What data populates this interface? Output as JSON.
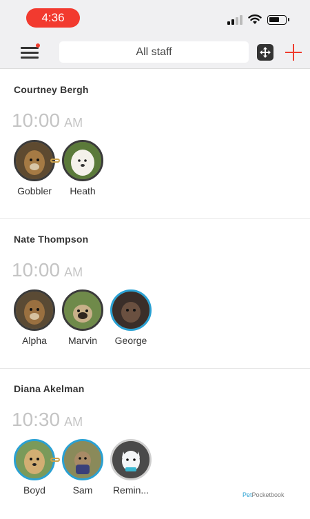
{
  "status_bar": {
    "time": "4:36"
  },
  "toolbar": {
    "filter_label": "All staff"
  },
  "colors": {
    "accent_red": "#ef3b2d",
    "highlight_blue": "#2aa1d3"
  },
  "sections": [
    {
      "staff": "Courtney Bergh",
      "time": "10:00",
      "ampm": "AM",
      "pets": [
        {
          "name": "Gobbler",
          "fur": "#8a6a3a"
        },
        {
          "name": "Heath",
          "fur": "#f3f0ea"
        }
      ]
    },
    {
      "staff": "Nate Thompson",
      "time": "10:00",
      "ampm": "AM",
      "pets": [
        {
          "name": "Alpha",
          "fur": "#7d5b34"
        },
        {
          "name": "Marvin",
          "fur": "#6d7a52"
        },
        {
          "name": "George",
          "fur": "#4a3a32"
        }
      ]
    },
    {
      "staff": "Diana Akelman",
      "time": "10:30",
      "ampm": "AM",
      "pets": [
        {
          "name": "Boyd",
          "fur": "#c9a56b"
        },
        {
          "name": "Sam",
          "fur": "#5b6a3a"
        },
        {
          "name": "Remin...",
          "fur": "#e9eef2"
        }
      ]
    }
  ],
  "brand": {
    "prefix": "Pet",
    "suffix": "Pocketbook"
  }
}
